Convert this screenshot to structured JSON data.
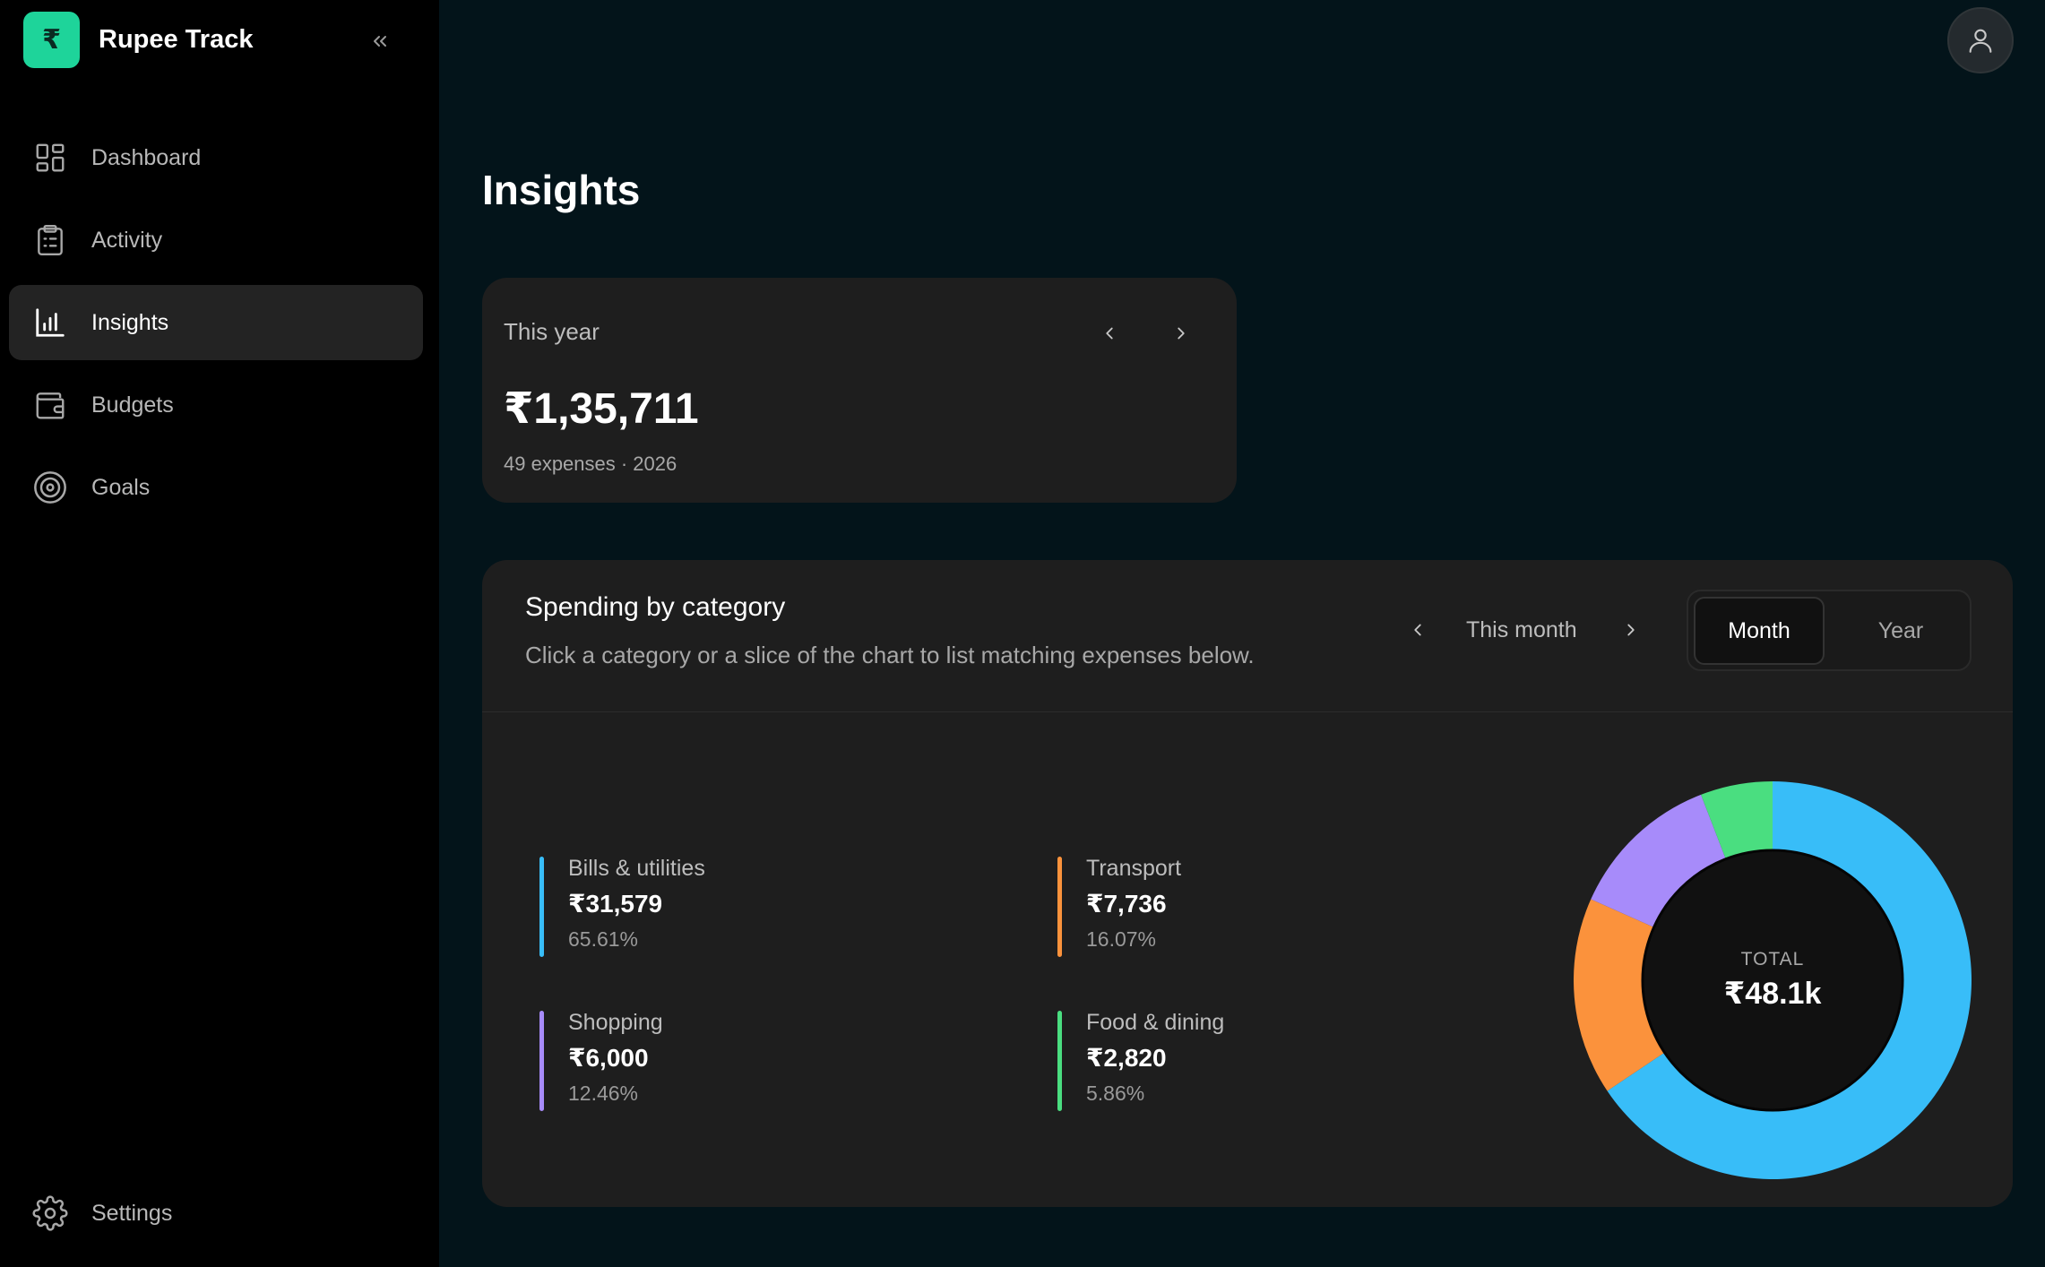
{
  "app": {
    "name": "Rupee Track",
    "logo_glyph": "₹",
    "accent_color": "#1ed49a"
  },
  "sidebar": {
    "items": [
      {
        "label": "Dashboard",
        "icon": "dashboard-grid-icon"
      },
      {
        "label": "Activity",
        "icon": "clipboard-list-icon"
      },
      {
        "label": "Insights",
        "icon": "bar-chart-icon",
        "active": true
      },
      {
        "label": "Budgets",
        "icon": "wallet-icon"
      },
      {
        "label": "Goals",
        "icon": "target-icon"
      }
    ],
    "settings_label": "Settings"
  },
  "page": {
    "title": "Insights"
  },
  "year_card": {
    "label": "This year",
    "amount": "₹1,35,711",
    "meta": "49 expenses · 2026"
  },
  "spending": {
    "title": "Spending by category",
    "subtitle": "Click a category or a slice of the chart to list matching expenses below.",
    "period_label": "This month",
    "toggle": {
      "month": "Month",
      "year": "Year",
      "selected": "Month"
    },
    "categories": [
      {
        "name": "Bills & utilities",
        "amount": "₹31,579",
        "pct": "65.61%",
        "color": "#38bdf8"
      },
      {
        "name": "Transport",
        "amount": "₹7,736",
        "pct": "16.07%",
        "color": "#fb923c"
      },
      {
        "name": "Shopping",
        "amount": "₹6,000",
        "pct": "12.46%",
        "color": "#a78bfa"
      },
      {
        "name": "Food & dining",
        "amount": "₹2,820",
        "pct": "5.86%",
        "color": "#4ade80"
      }
    ],
    "total_caption": "TOTAL",
    "total_value": "₹48.1k"
  },
  "chart_data": {
    "type": "pie",
    "categories": [
      "Bills & utilities",
      "Transport",
      "Shopping",
      "Food & dining"
    ],
    "values": [
      65.61,
      16.07,
      12.46,
      5.86
    ],
    "colors": [
      "#38bdf8",
      "#fb923c",
      "#a78bfa",
      "#4ade80"
    ]
  }
}
